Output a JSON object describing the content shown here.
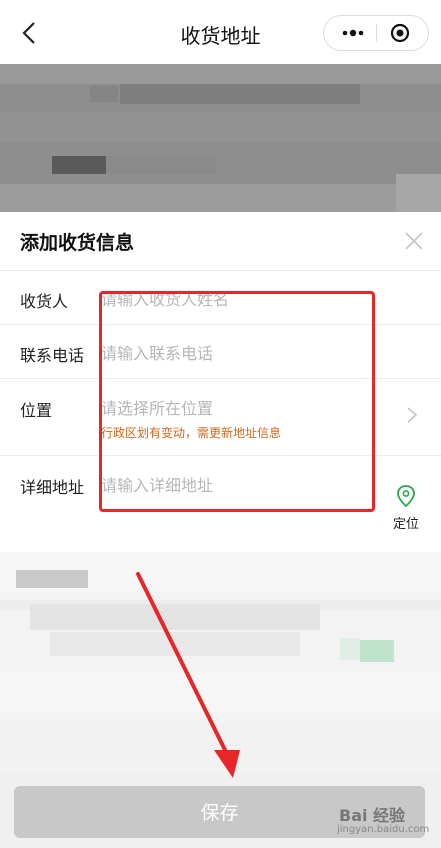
{
  "header": {
    "title": "收货地址"
  },
  "form": {
    "title": "添加收货信息",
    "fields": [
      {
        "label": "收货人",
        "placeholder": "请输入收货人姓名"
      },
      {
        "label": "联系电话",
        "placeholder": "请输入联系电话"
      },
      {
        "label": "位置",
        "placeholder": "请选择所在位置",
        "notice": "行政区划有变动，需更新地址信息"
      },
      {
        "label": "详细地址",
        "placeholder": "请输入详细地址"
      }
    ],
    "locate_label": "定位"
  },
  "footer": {
    "save_label": "保存"
  },
  "watermark": {
    "brand": "Bai 经验",
    "site": "jingyan.baidu.com"
  },
  "colors": {
    "annotation_red": "#e8262a",
    "notice_orange": "#d2691e",
    "locate_green": "#2aa84a"
  }
}
